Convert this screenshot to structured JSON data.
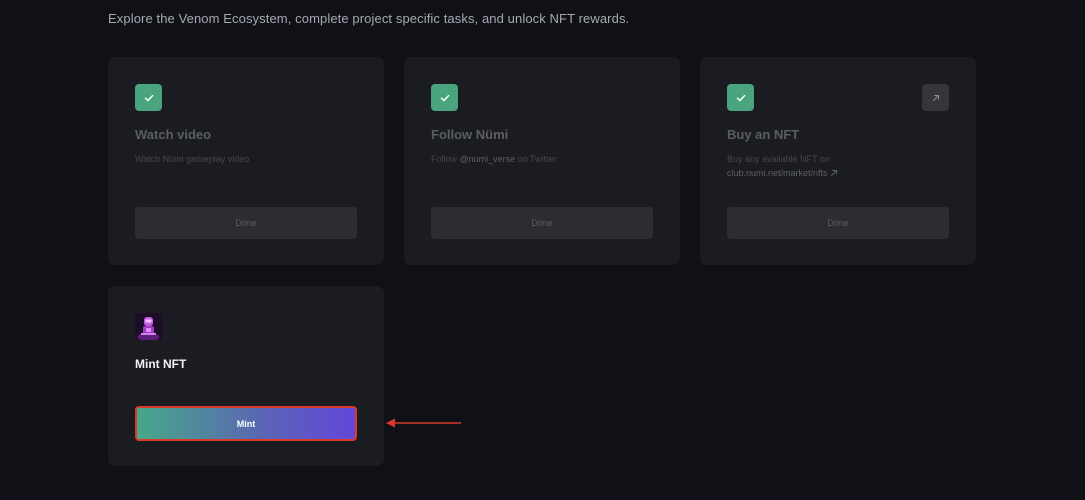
{
  "intro": "Explore the Venom Ecosystem, complete project specific tasks, and unlock NFT rewards.",
  "tasks": [
    {
      "title": "Watch video",
      "description": "Watch Nümi gameplay video",
      "button": "Done",
      "icon": "check-icon"
    },
    {
      "title": "Follow Nümi",
      "description_prefix": "Follow ",
      "description_handle": "@numi_verse",
      "description_suffix": " on Twitter",
      "button": "Done",
      "icon": "check-icon"
    },
    {
      "title": "Buy an NFT",
      "description": "Buy any available NFT on",
      "description_link": "club.numi.net/market/nfts",
      "button": "Done",
      "icon": "check-icon",
      "link_icon": "external-link-icon"
    }
  ],
  "mint": {
    "title": "Mint NFT",
    "button": "Mint",
    "thumbnail": "nft-thumbnail"
  },
  "annotation": {
    "icon": "red-arrow-icon",
    "color": "#d8392b"
  },
  "colors": {
    "background": "#101116",
    "card": "#1b1c22",
    "success": "#4aa57f",
    "mint_gradient_start": "#48a889",
    "mint_gradient_end": "#6447d9"
  }
}
